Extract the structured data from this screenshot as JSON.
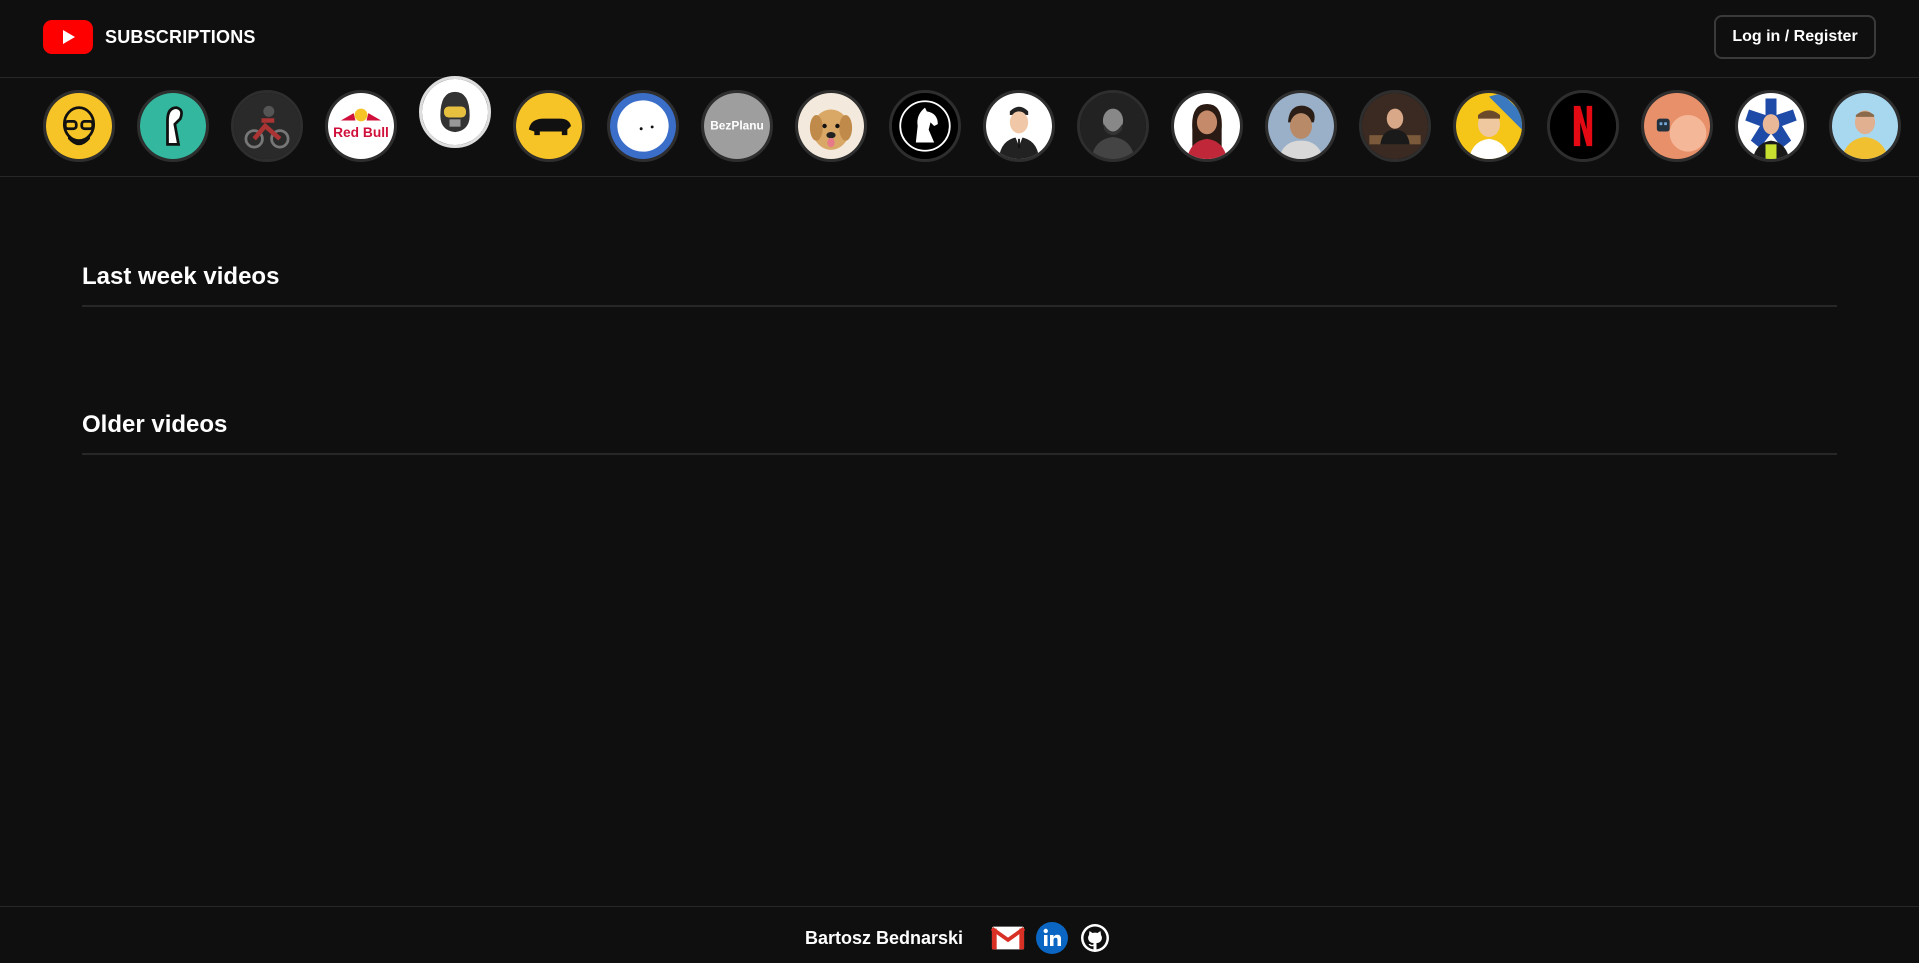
{
  "header": {
    "logo_icon": "youtube-play-icon",
    "title": "SUBSCRIPTIONS",
    "login_label": "Log in / Register"
  },
  "channels": [
    {
      "name": "channel-1",
      "color": "#f7c427"
    },
    {
      "name": "channel-2",
      "color": "#33b79f"
    },
    {
      "name": "channel-3",
      "color": "#2a2a2a"
    },
    {
      "name": "channel-4",
      "text": "Red Bull",
      "color": "#ffffff"
    },
    {
      "name": "channel-5",
      "color": "#ffffff"
    },
    {
      "name": "channel-6",
      "color": "#f7c427"
    },
    {
      "name": "channel-7",
      "color": "#3a6ec9"
    },
    {
      "name": "channel-8",
      "text": "BezPlanu",
      "color": "#9e9e9e"
    },
    {
      "name": "channel-9",
      "color": "#d9a766"
    },
    {
      "name": "channel-10",
      "color": "#000000"
    },
    {
      "name": "channel-11",
      "color": "#ffffff"
    },
    {
      "name": "channel-12",
      "color": "#222222"
    },
    {
      "name": "channel-13",
      "color": "#c48a6a"
    },
    {
      "name": "channel-14",
      "color": "#6a5a4a"
    },
    {
      "name": "channel-15",
      "color": "#3a2a22"
    },
    {
      "name": "channel-16",
      "color": "#f5c518"
    },
    {
      "name": "channel-17",
      "color": "#000000"
    },
    {
      "name": "channel-18",
      "color": "#e8906a"
    },
    {
      "name": "channel-19",
      "color": "#ffffff"
    },
    {
      "name": "channel-20",
      "color": "#f0c030"
    }
  ],
  "sections": {
    "last_week_title": "Last week videos",
    "older_title": "Older videos"
  },
  "footer": {
    "author": "Bartosz Bednarski",
    "icons": [
      "gmail-icon",
      "linkedin-icon",
      "github-icon"
    ]
  }
}
